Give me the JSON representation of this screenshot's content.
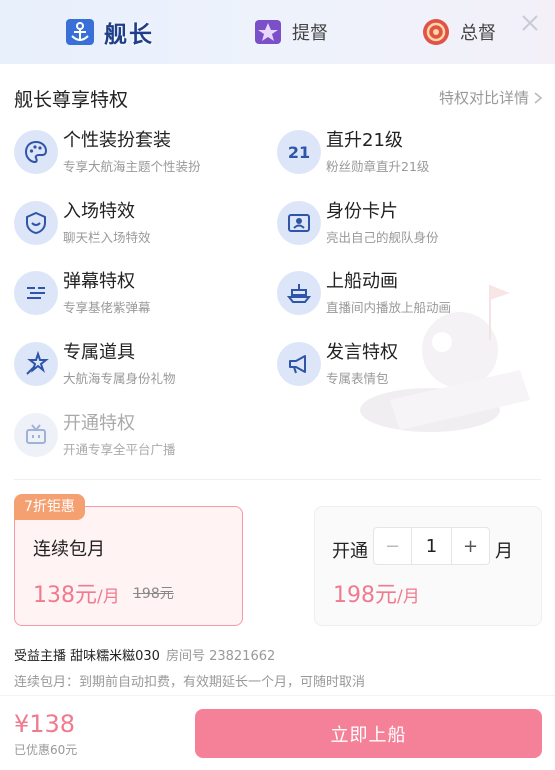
{
  "tabs": [
    {
      "label": "舰长",
      "active": true
    },
    {
      "label": "提督",
      "active": false
    },
    {
      "label": "总督",
      "active": false
    }
  ],
  "section": {
    "title": "舰长尊享特权",
    "compare_link": "特权对比详情"
  },
  "privileges": [
    {
      "name": "个性装扮套装",
      "desc": "专享大航海主题个性装扮",
      "icon": "palette-icon"
    },
    {
      "name": "直升21级",
      "desc": "粉丝勋章直升21级",
      "icon": "level-21-icon"
    },
    {
      "name": "入场特效",
      "desc": "聊天栏入场特效",
      "icon": "entrance-badge-icon"
    },
    {
      "name": "身份卡片",
      "desc": "亮出自己的舰队身份",
      "icon": "id-card-icon"
    },
    {
      "name": "弹幕特权",
      "desc": "专享基佬紫弹幕",
      "icon": "danmaku-icon"
    },
    {
      "name": "上船动画",
      "desc": "直播间内播放上船动画",
      "icon": "ship-icon"
    },
    {
      "name": "专属道具",
      "desc": "大航海专属身份礼物",
      "icon": "magic-wand-icon"
    },
    {
      "name": "发言特权",
      "desc": "专属表情包",
      "icon": "megaphone-icon"
    },
    {
      "name": "开通特权",
      "desc": "开通专享全平台广播",
      "icon": "tv-icon"
    }
  ],
  "plans": {
    "continuous": {
      "promo": "7折钜惠",
      "name": "连续包月",
      "price": "138元",
      "unit": "/月",
      "old_price": "198元"
    },
    "single": {
      "open_label": "开通",
      "minus": "−",
      "quantity": "1",
      "plus": "+",
      "unit_label": "月",
      "price": "198元",
      "unit": "/月"
    }
  },
  "beneficiary": {
    "text": "受益主播 甜味糯米糍030",
    "room": "房间号 23821662"
  },
  "note": "连续包月：到期前自动扣费，有效期延长一个月，可随时取消",
  "footer": {
    "total": "¥138",
    "saved": "已优惠60元",
    "button": "立即上船"
  },
  "colors": {
    "accent_pink": "#f07a8e",
    "button_pink": "#f48198",
    "icon_blue": "#2f55a8",
    "promo_orange": "#f5a071"
  }
}
